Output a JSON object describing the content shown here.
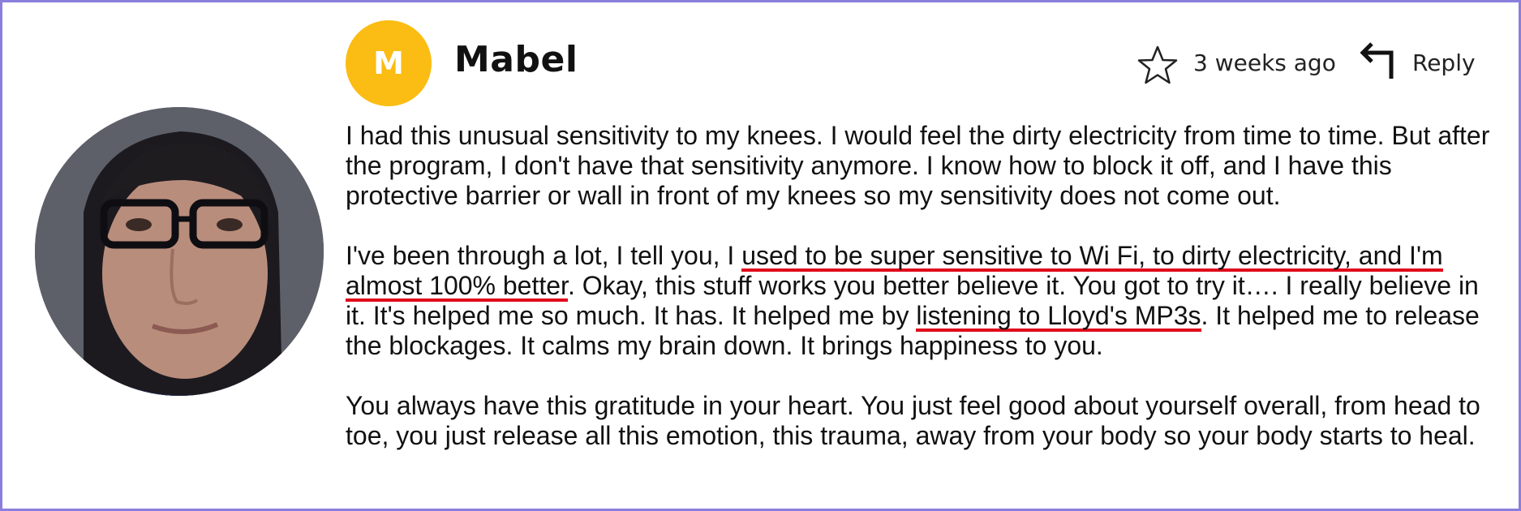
{
  "author": {
    "name": "Mabel",
    "initial": "M",
    "avatar_color": "#fbbc13"
  },
  "meta": {
    "timestamp": "3 weeks ago",
    "reply_label": "Reply",
    "star_icon": "star-icon",
    "reply_icon": "reply-arrow-icon"
  },
  "review": {
    "p1": "I had this unusual sensitivity to my knees. I would feel the dirty electricity from time to time. But after the program, I don't have that sensitivity anymore. I know how to block it off, and I have this protective barrier or wall in front of my knees so my sensitivity does not come out.",
    "p2_a": "I've been through a lot, I tell you, I ",
    "p2_u1": "used to be super sensitive to Wi Fi, to dirty electricity, and I'm almost 100% better",
    "p2_b": ". Okay, this stuff works you better believe it. You got to try it…. I really believe in it. It's helped me so much. It has. It helped me by ",
    "p2_u2": "listening to Lloyd's MP3s",
    "p2_c": ". It helped me to release the blockages. It calms my brain down. It brings happiness to you.",
    "p3": "You always have this gratitude in your heart. You just feel good about yourself overall, from head to toe, you just release all this emotion, this trauma, away from your body so your body starts to heal."
  },
  "colors": {
    "border": "#8b7fdc",
    "underline": "#e00b1c"
  }
}
